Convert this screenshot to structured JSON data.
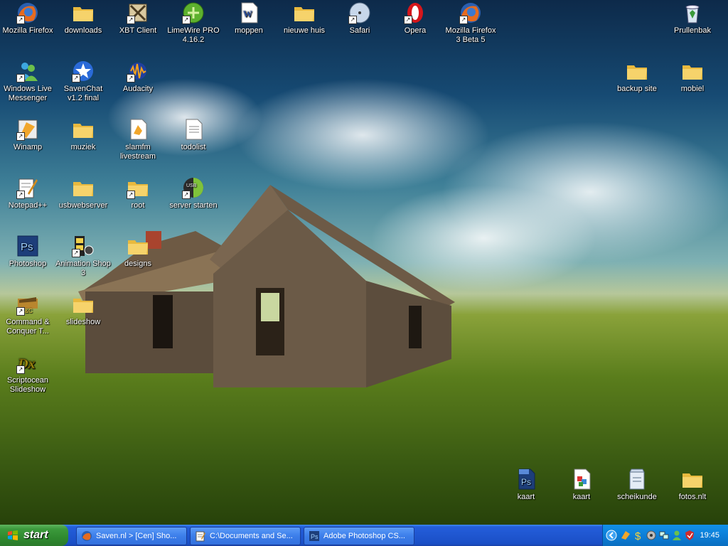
{
  "desktop": {
    "icons": [
      {
        "label": "Mozilla Firefox",
        "icon": "firefox-icon"
      },
      {
        "label": "downloads",
        "icon": "folder-icon"
      },
      {
        "label": "XBT Client",
        "icon": "xbt-icon"
      },
      {
        "label": "LimeWire PRO 4.16.2",
        "icon": "limewire-icon"
      },
      {
        "label": "moppen",
        "icon": "word-document-icon"
      },
      {
        "label": "nieuwe huis",
        "icon": "folder-icon"
      },
      {
        "label": "Safari",
        "icon": "safari-icon"
      },
      {
        "label": "Opera",
        "icon": "opera-icon"
      },
      {
        "label": "Mozilla Firefox 3 Beta 5",
        "icon": "firefox-icon"
      },
      {
        "label": "Prullenbak",
        "icon": "recycle-bin-icon"
      },
      {
        "label": "Windows Live Messenger",
        "icon": "messenger-icon"
      },
      {
        "label": "SavenChat v1.2 final",
        "icon": "star-icon"
      },
      {
        "label": "Audacity",
        "icon": "audacity-icon"
      },
      {
        "label": "backup site",
        "icon": "folder-icon"
      },
      {
        "label": "mobiel",
        "icon": "folder-icon"
      },
      {
        "label": "Winamp",
        "icon": "winamp-icon"
      },
      {
        "label": "muziek",
        "icon": "folder-icon"
      },
      {
        "label": "slamfm livestream",
        "icon": "stream-file-icon"
      },
      {
        "label": "todolist",
        "icon": "text-file-icon"
      },
      {
        "label": "Notepad++",
        "icon": "notepad-icon"
      },
      {
        "label": "usbwebserver",
        "icon": "folder-icon"
      },
      {
        "label": "root",
        "icon": "folder-icon"
      },
      {
        "label": "server starten",
        "icon": "server-icon"
      },
      {
        "label": "Photoshop",
        "icon": "photoshop-icon"
      },
      {
        "label": "Animation Shop 3",
        "icon": "animation-shop-icon"
      },
      {
        "label": "designs",
        "icon": "folder-icon"
      },
      {
        "label": "Command & Conquer T...",
        "icon": "cnc-icon"
      },
      {
        "label": "slideshow",
        "icon": "folder-icon"
      },
      {
        "label": "Scriptocean Slideshow",
        "icon": "scriptocean-icon"
      },
      {
        "label": "kaart",
        "icon": "psd-file-icon"
      },
      {
        "label": "kaart",
        "icon": "image-file-icon"
      },
      {
        "label": "scheikunde",
        "icon": "archive-icon"
      },
      {
        "label": "fotos.nlt",
        "icon": "folder-icon"
      }
    ]
  },
  "taskbar": {
    "start_label": "start",
    "tasks": [
      {
        "label": "Saven.nl > [Cen] Sho...",
        "icon": "firefox-icon"
      },
      {
        "label": "C:\\Documents and Se...",
        "icon": "notepad-icon"
      },
      {
        "label": "Adobe Photoshop CS...",
        "icon": "photoshop-icon"
      }
    ],
    "tray_icons": [
      "chevron-left-icon",
      "winamp-icon",
      "dollar-icon",
      "speaker-icon",
      "network-icon",
      "messenger-icon",
      "security-shield-icon"
    ],
    "clock": "19:45"
  },
  "colors": {
    "taskbar_blue": "#245edb",
    "start_green": "#3c9a3c",
    "tray_blue": "#0c7fd8",
    "folder_yellow": "#f3d36b"
  }
}
